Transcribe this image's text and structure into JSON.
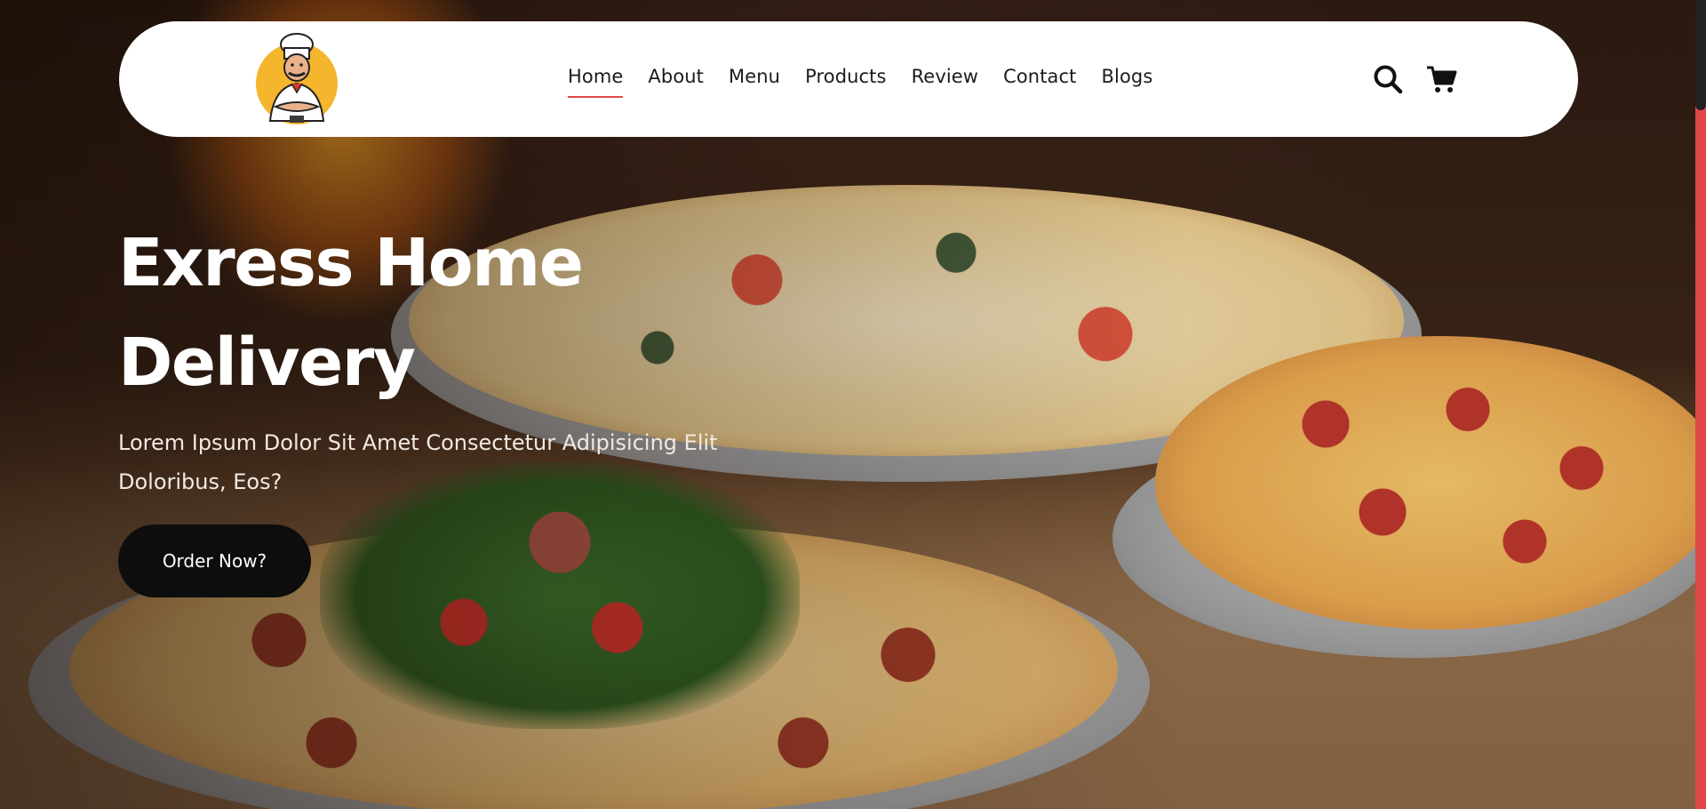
{
  "brand": {
    "logo_icon": "chef-mascot-icon"
  },
  "nav": {
    "items": [
      {
        "label": "Home",
        "active": true
      },
      {
        "label": "About"
      },
      {
        "label": "Menu"
      },
      {
        "label": "Products"
      },
      {
        "label": "Review"
      },
      {
        "label": "Contact"
      },
      {
        "label": "Blogs"
      }
    ]
  },
  "header_icons": {
    "search": "search-icon",
    "cart": "cart-icon"
  },
  "hero": {
    "title_line1": "Exress Home",
    "title_line2": "Delivery",
    "subtitle_line1": "Lorem Ipsum Dolor Sit Amet Consectetur Adipisicing Elit",
    "subtitle_line2": "Doloribus, Eos?",
    "cta_label": "Order Now?"
  },
  "colors": {
    "accent": "#e04848",
    "header_bg": "#ffffff",
    "button_bg": "#0d0d0d",
    "logo_circle": "#f5b52c"
  }
}
